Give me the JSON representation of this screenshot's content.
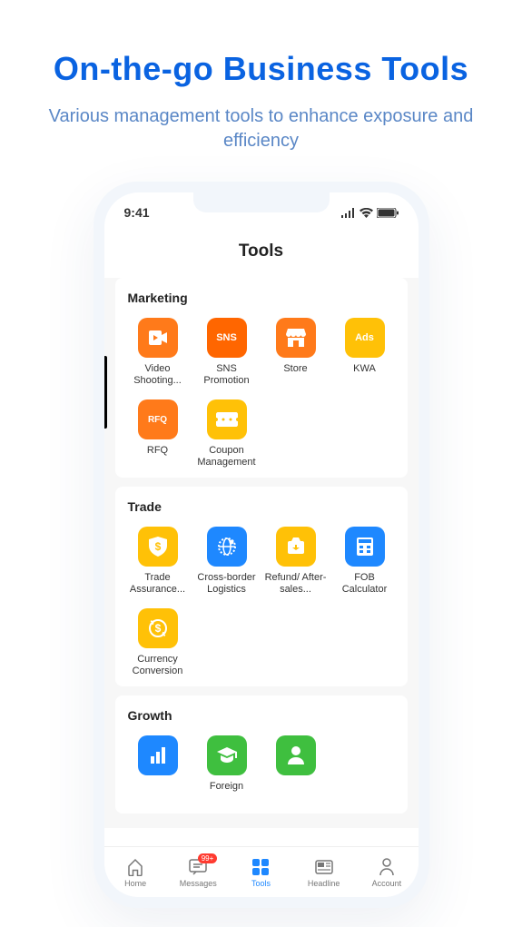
{
  "hero": {
    "title": "On-the-go Business Tools",
    "subtitle": "Various management tools to enhance exposure and efficiency"
  },
  "statusbar": {
    "time": "9:41"
  },
  "page": {
    "title": "Tools"
  },
  "sections": {
    "marketing": {
      "title": "Marketing",
      "items": [
        {
          "label": "Video Shooting...",
          "icon_text": "▶",
          "cls": "c-orange"
        },
        {
          "label": "SNS Promotion",
          "icon_text": "SNS",
          "cls": "c-orange2"
        },
        {
          "label": "Store",
          "icon_text": "",
          "cls": "c-orange"
        },
        {
          "label": "KWA",
          "icon_text": "Ads",
          "cls": "c-yellow"
        },
        {
          "label": "RFQ",
          "icon_text": "RFQ",
          "cls": "c-orange"
        },
        {
          "label": "Coupon Management",
          "icon_text": "",
          "cls": "c-yellow"
        }
      ]
    },
    "trade": {
      "title": "Trade",
      "items": [
        {
          "label": "Trade Assurance...",
          "icon_text": "$",
          "cls": "c-yellow"
        },
        {
          "label": "Cross-border Logistics",
          "icon_text": "",
          "cls": "c-blue"
        },
        {
          "label": "Refund/ After-sales...",
          "icon_text": "",
          "cls": "c-yellow"
        },
        {
          "label": "FOB Calculator",
          "icon_text": "",
          "cls": "c-blue"
        },
        {
          "label": "Currency Conversion",
          "icon_text": "",
          "cls": "c-yellow"
        }
      ]
    },
    "growth": {
      "title": "Growth",
      "items": [
        {
          "label": "",
          "icon_text": "",
          "cls": "c-blue"
        },
        {
          "label": "Foreign",
          "icon_text": "",
          "cls": "c-green"
        },
        {
          "label": "",
          "icon_text": "",
          "cls": "c-green"
        }
      ]
    }
  },
  "tabs": {
    "home": "Home",
    "messages": "Messages",
    "tools": "Tools",
    "headline": "Headline",
    "account": "Account",
    "badge": "99+"
  }
}
